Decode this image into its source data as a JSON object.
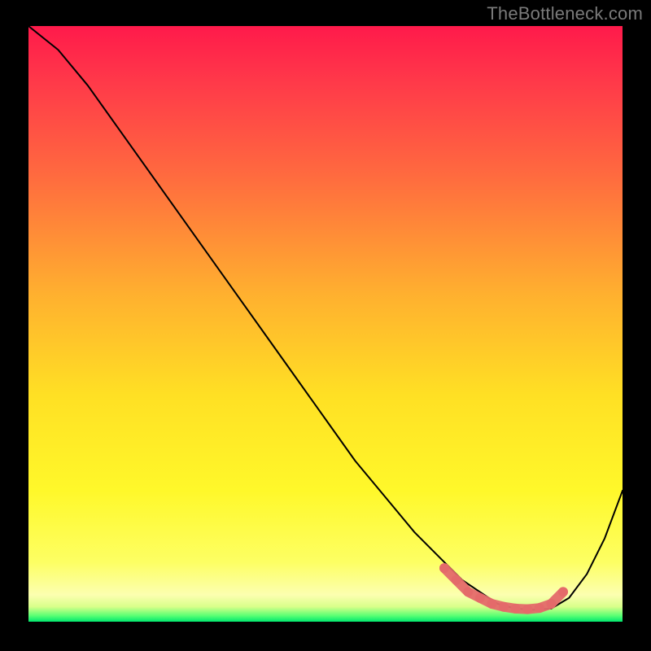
{
  "attribution": "TheBottleneck.com",
  "chart_data": {
    "type": "line",
    "title": "",
    "xlabel": "",
    "ylabel": "",
    "xlim": [
      0,
      100
    ],
    "ylim": [
      0,
      100
    ],
    "grid": false,
    "legend": false,
    "axes_visible": false,
    "background_gradient_stops": [
      {
        "pos": 0.0,
        "color": "#ff1a4b"
      },
      {
        "pos": 0.1,
        "color": "#ff3b49"
      },
      {
        "pos": 0.25,
        "color": "#ff6a3f"
      },
      {
        "pos": 0.45,
        "color": "#ffb02f"
      },
      {
        "pos": 0.62,
        "color": "#ffe024"
      },
      {
        "pos": 0.78,
        "color": "#fff82a"
      },
      {
        "pos": 0.9,
        "color": "#fdff63"
      },
      {
        "pos": 0.955,
        "color": "#fcffb0"
      },
      {
        "pos": 0.975,
        "color": "#d8ff8a"
      },
      {
        "pos": 0.99,
        "color": "#59ff74"
      },
      {
        "pos": 1.0,
        "color": "#00e66e"
      }
    ],
    "series": [
      {
        "name": "bottleneck-curve",
        "color": "#000000",
        "stroke_width": 2,
        "x": [
          0,
          5,
          10,
          15,
          20,
          25,
          30,
          35,
          40,
          45,
          50,
          55,
          60,
          65,
          70,
          73,
          76,
          79,
          82,
          85,
          88,
          91,
          94,
          97,
          100
        ],
        "y": [
          100,
          96,
          90,
          83,
          76,
          69,
          62,
          55,
          48,
          41,
          34,
          27,
          21,
          15,
          10,
          7,
          5,
          3,
          2.2,
          2.0,
          2.2,
          4,
          8,
          14,
          22
        ]
      },
      {
        "name": "optimal-range-markers",
        "color": "#e46a6a",
        "type": "scatter",
        "marker_radius": 6,
        "x": [
          70,
          72,
          74,
          76,
          78,
          80,
          82,
          84,
          86,
          88,
          90
        ],
        "y": [
          9,
          7,
          5,
          4,
          3,
          2.5,
          2.2,
          2.1,
          2.3,
          3,
          5
        ]
      }
    ],
    "annotations": []
  }
}
